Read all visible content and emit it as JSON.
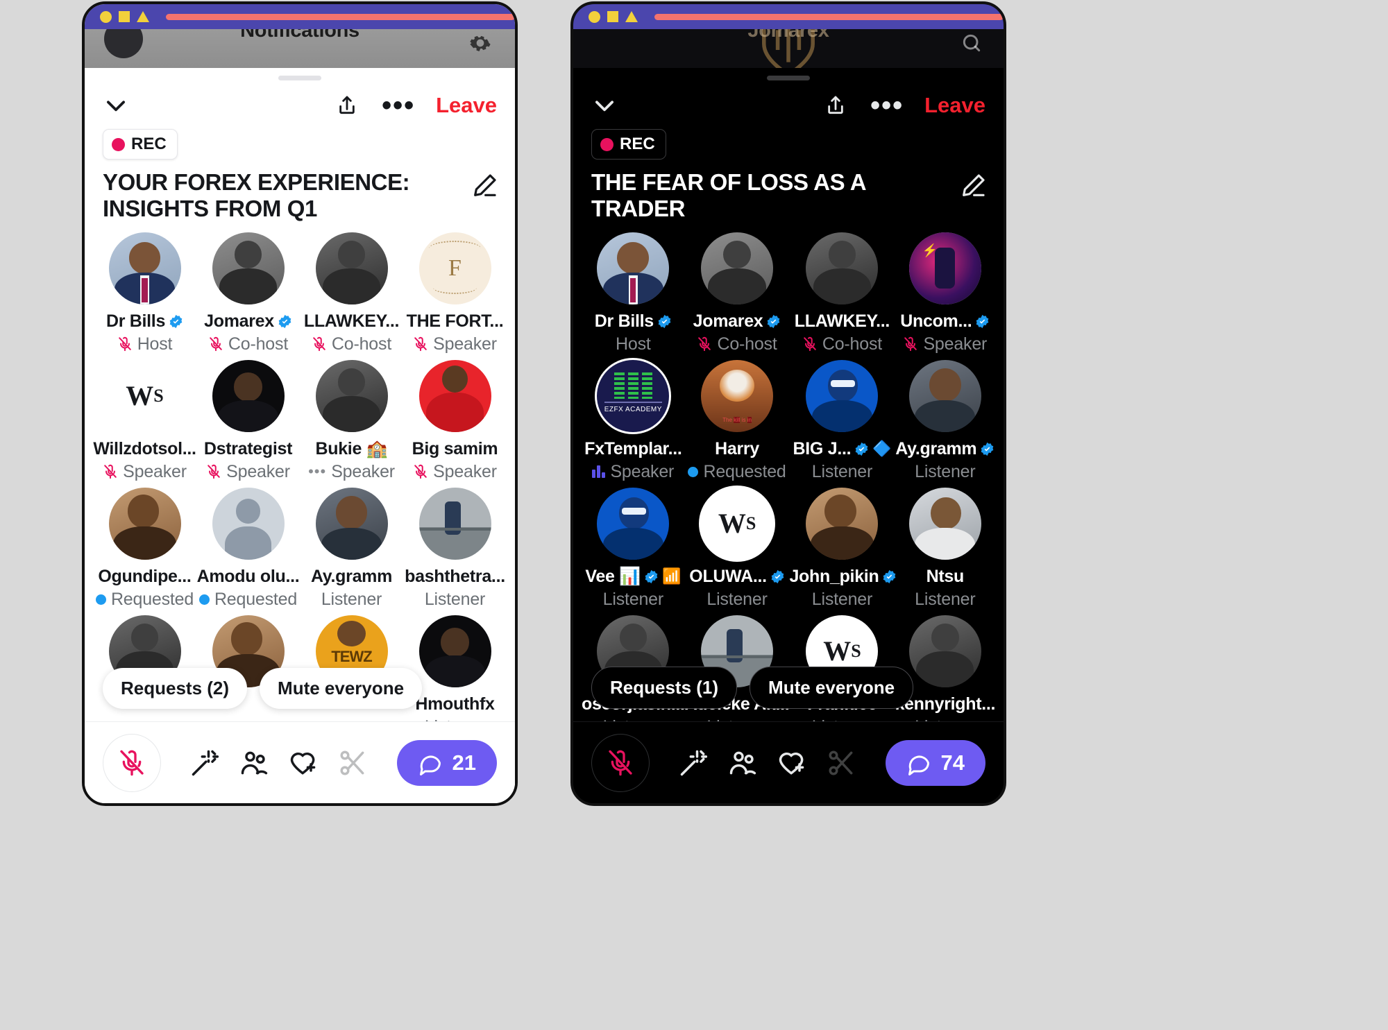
{
  "window": {
    "traffic": [
      "circle",
      "square",
      "triangle"
    ],
    "accent_purple": "#4b46ad",
    "progress_color": "#f4736e"
  },
  "panels": [
    {
      "id": "left",
      "theme": "light",
      "backdrop_title": "Notifications",
      "header": {
        "collapse_icon": "chevron-down-icon",
        "share_icon": "share-icon",
        "more_icon": "more-horizontal-icon",
        "leave_label": "Leave"
      },
      "recording": {
        "label": "REC",
        "active": true
      },
      "room_title": "YOUR FOREX EXPERIENCE: INSIGHTS FROM Q1",
      "edit_icon": "pencil-icon",
      "participants": [
        {
          "name": "Dr Bills",
          "role": "Host",
          "verified": true,
          "muted": true,
          "art": "bg-blue"
        },
        {
          "name": "Jomarex",
          "role": "Co-host",
          "verified": true,
          "muted": true,
          "art": "bg-gray"
        },
        {
          "name": "LLAWKEY...",
          "role": "Co-host",
          "verified": false,
          "muted": true,
          "art": "bg-dkgry"
        },
        {
          "name": "THE FORT...",
          "role": "Speaker",
          "verified": false,
          "muted": true,
          "art": "bg-cream"
        },
        {
          "name": "Willzdotsol...",
          "role": "Speaker",
          "verified": false,
          "muted": true,
          "art": "bg-white"
        },
        {
          "name": "Dstrategist",
          "role": "Speaker",
          "verified": false,
          "muted": true,
          "art": "bg-black"
        },
        {
          "name": "Bukie 🏫",
          "role": "Speaker",
          "verified": false,
          "muted": false,
          "dots": true,
          "art": "bg-dkgry"
        },
        {
          "name": "Big samim",
          "role": "Speaker",
          "verified": false,
          "muted": true,
          "art": "bg-red"
        },
        {
          "name": "Ogundipe...",
          "role": "Requested",
          "verified": false,
          "requested": true,
          "art": "bg-brown"
        },
        {
          "name": "Amodu olu...",
          "role": "Requested",
          "verified": false,
          "requested": true,
          "art": "bg-ltgray"
        },
        {
          "name": "Ay.gramm",
          "role": "Listener",
          "verified": false,
          "art": "bg-slate"
        },
        {
          "name": "bashthetra...",
          "role": "Listener",
          "verified": false,
          "art": "bg-street"
        },
        {
          "name": "",
          "role": "",
          "art": "bg-dkgry"
        },
        {
          "name": "",
          "role": "",
          "art": "bg-brown"
        },
        {
          "name": "",
          "role": "",
          "art": "bg-orange"
        },
        {
          "name": "Hmouthfx",
          "role": "Listener",
          "verified": false,
          "art": "bg-black"
        }
      ],
      "pills": {
        "requests_label": "Requests (2)",
        "mute_label": "Mute everyone"
      },
      "actionbar": {
        "mic_icon": "mic-muted-icon",
        "tools": [
          "magic-wand-icon",
          "people-icon",
          "heart-plus-icon",
          "scissors-icon"
        ],
        "chat_icon": "chat-bubble-icon",
        "chat_count": "21"
      }
    },
    {
      "id": "right",
      "theme": "dark",
      "backdrop_title": "Jomarex",
      "header": {
        "collapse_icon": "chevron-down-icon",
        "share_icon": "share-icon",
        "more_icon": "more-horizontal-icon",
        "leave_label": "Leave"
      },
      "recording": {
        "label": "REC",
        "active": true
      },
      "room_title": "THE FEAR OF LOSS AS A TRADER",
      "edit_icon": "pencil-icon",
      "participants": [
        {
          "name": "Dr Bills",
          "role": "Host",
          "verified": true,
          "art": "bg-blue"
        },
        {
          "name": "Jomarex",
          "role": "Co-host",
          "verified": true,
          "muted": true,
          "art": "bg-gray"
        },
        {
          "name": "LLAWKEY...",
          "role": "Co-host",
          "verified": false,
          "muted": true,
          "art": "bg-dkgry"
        },
        {
          "name": "Uncom...",
          "role": "Speaker",
          "verified": true,
          "muted": true,
          "art": "bg-neon"
        },
        {
          "name": "FxTemplar...",
          "role": "Speaker",
          "verified": false,
          "speaking": true,
          "ring": true,
          "art": "bg-navy"
        },
        {
          "name": "Harry",
          "role": "Requested",
          "verified": false,
          "requested": true,
          "art": "bg-tiger"
        },
        {
          "name": "BIG J...",
          "role": "Listener",
          "verified": true,
          "extra_emoji": "🔷",
          "art": "bg-blue2"
        },
        {
          "name": "Ay.gramm",
          "role": "Listener",
          "verified": true,
          "art": "bg-slate"
        },
        {
          "name": "Vee 📊",
          "role": "Listener",
          "verified": true,
          "extra_emoji": "📶",
          "art": "bg-blue2"
        },
        {
          "name": "OLUWA...",
          "role": "Listener",
          "verified": true,
          "ring": true,
          "art": "bg-white"
        },
        {
          "name": "John_pikin",
          "role": "Listener",
          "verified": true,
          "art": "bg-brown"
        },
        {
          "name": "Ntsu",
          "role": "Listener",
          "verified": false,
          "art": "bg-silver"
        },
        {
          "name": "oseorjiasin...",
          "role": "Listener",
          "verified": false,
          "art": "bg-dkgry"
        },
        {
          "name": "Adeleke Ak...",
          "role": "Listener",
          "verified": false,
          "art": "bg-street"
        },
        {
          "name": "Frankiee",
          "role": "Listener",
          "verified": false,
          "art": "bg-white"
        },
        {
          "name": "kennyright...",
          "role": "Listener",
          "verified": false,
          "art": "bg-dkgry"
        }
      ],
      "pills": {
        "requests_label": "Requests (1)",
        "mute_label": "Mute everyone"
      },
      "actionbar": {
        "mic_icon": "mic-muted-icon",
        "tools": [
          "magic-wand-icon",
          "people-icon",
          "heart-plus-icon",
          "scissors-icon"
        ],
        "chat_icon": "chat-bubble-icon",
        "chat_count": "74"
      }
    }
  ]
}
